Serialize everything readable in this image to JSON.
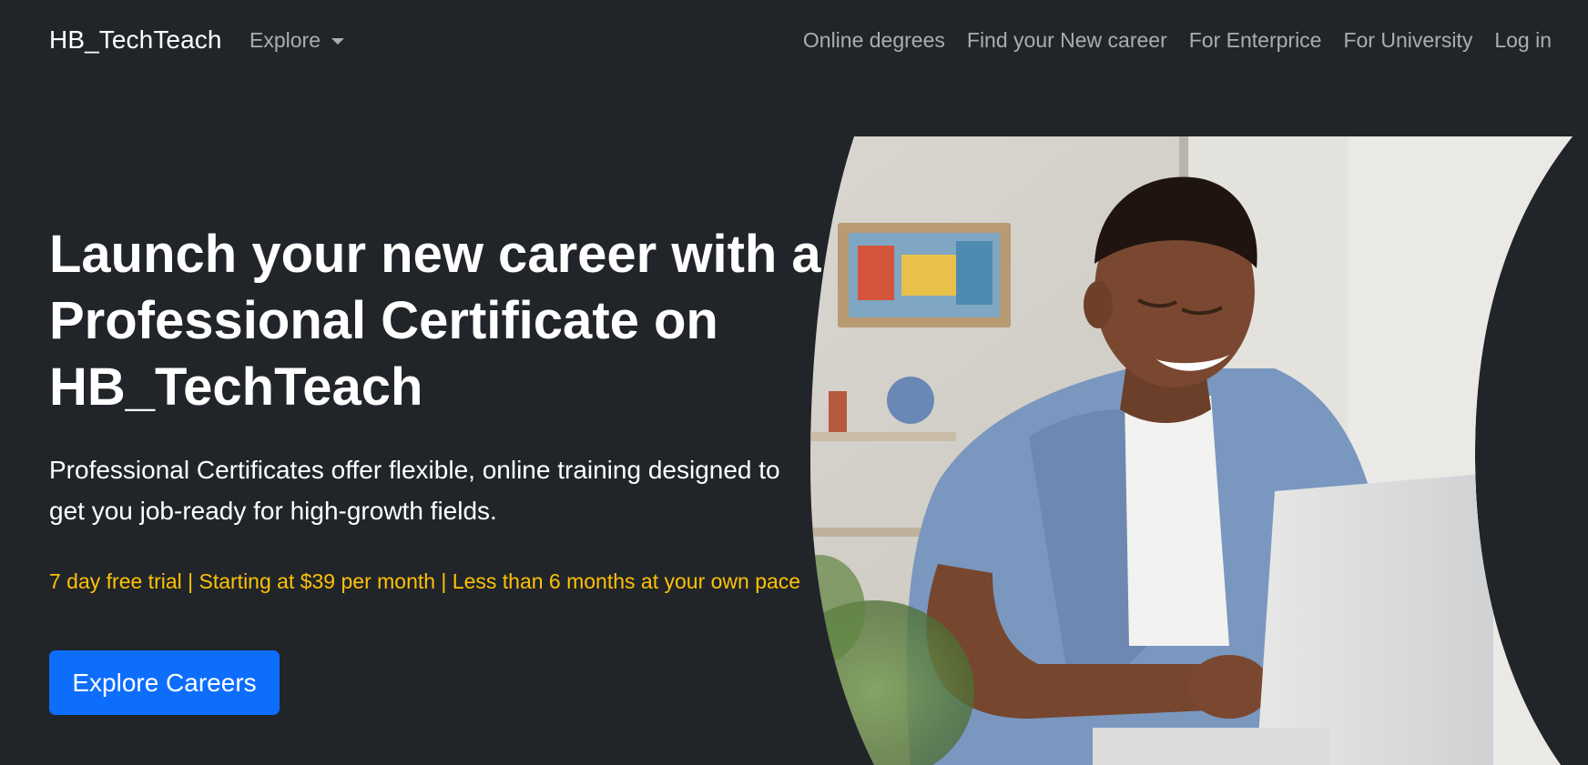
{
  "nav": {
    "brand": "HB_TechTeach",
    "explore_label": "Explore",
    "links": [
      "Online degrees",
      "Find your New career",
      "For Enterprice",
      "For University",
      "Log in"
    ]
  },
  "hero": {
    "title": "Launch your new career with a Professional Certificate on HB_TechTeach",
    "lead": "Professional Certificates offer flexible, online training designed to get you job-ready for high-growth fields.",
    "note": "7 day free trial | Starting at $39 per month | Less than 6 months at your own pace",
    "cta_label": "Explore Careers",
    "image_subject": "smiling man in a denim shirt working on a laptop"
  },
  "colors": {
    "background": "#212529",
    "accent": "#0d6efd",
    "note": "#ffc107"
  }
}
